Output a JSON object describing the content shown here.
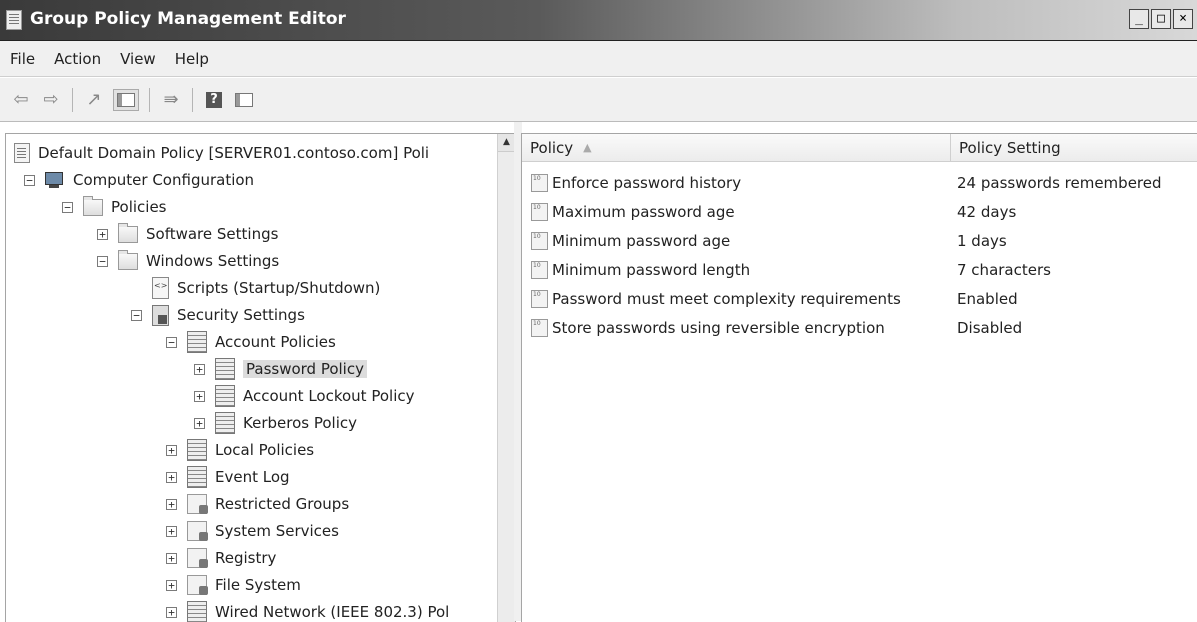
{
  "window": {
    "title": "Group Policy Management Editor",
    "controls": [
      "_",
      "□",
      "×"
    ]
  },
  "menu": [
    "File",
    "Action",
    "View",
    "Help"
  ],
  "tree": {
    "root": "Default Domain Policy [SERVER01.contoso.com] Poli",
    "computer_configuration": "Computer Configuration",
    "policies": "Policies",
    "software_settings": "Software Settings",
    "windows_settings": "Windows Settings",
    "scripts": "Scripts (Startup/Shutdown)",
    "security_settings": "Security Settings",
    "account_policies": "Account Policies",
    "password_policy": "Password Policy",
    "account_lockout_policy": "Account Lockout Policy",
    "kerberos_policy": "Kerberos Policy",
    "local_policies": "Local Policies",
    "event_log": "Event Log",
    "restricted_groups": "Restricted Groups",
    "system_services": "System Services",
    "registry": "Registry",
    "file_system": "File System",
    "wired_network": "Wired Network (IEEE 802.3) Pol"
  },
  "list": {
    "columns": {
      "policy": "Policy",
      "setting": "Policy Setting"
    },
    "rows": [
      {
        "policy": "Enforce password history",
        "setting": "24 passwords remembered"
      },
      {
        "policy": "Maximum password age",
        "setting": "42 days"
      },
      {
        "policy": "Minimum password age",
        "setting": "1 days"
      },
      {
        "policy": "Minimum password length",
        "setting": "7 characters"
      },
      {
        "policy": "Password must meet complexity requirements",
        "setting": "Enabled"
      },
      {
        "policy": "Store passwords using reversible encryption",
        "setting": "Disabled"
      }
    ]
  }
}
